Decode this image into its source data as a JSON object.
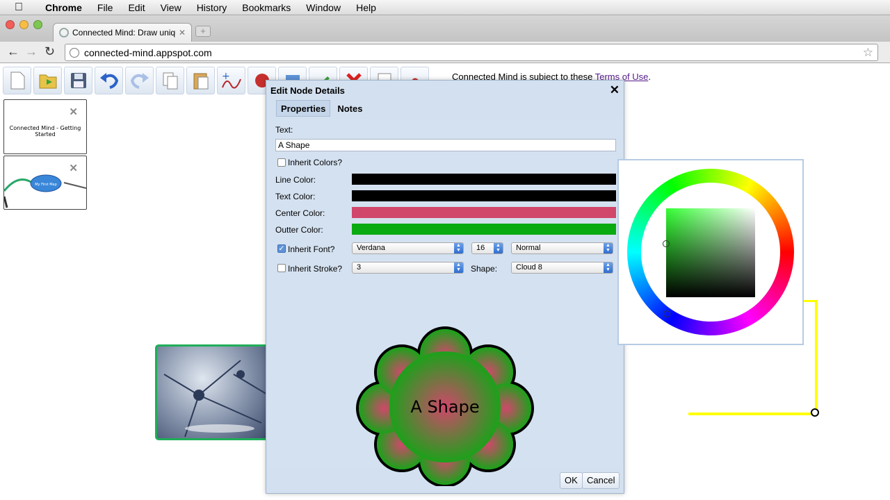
{
  "menubar": {
    "app": "Chrome",
    "items": [
      "File",
      "Edit",
      "View",
      "History",
      "Bookmarks",
      "Window",
      "Help"
    ]
  },
  "browser": {
    "tab_title": "Connected Mind: Draw uniqu",
    "url": "connected-mind.appspot.com"
  },
  "page": {
    "terms_prefix": "Connected Mind is subject to these",
    "terms_link": "Terms of Use",
    "terms_suffix": ".",
    "thumbnails": [
      {
        "label": "Connected Mind - Getting Started"
      },
      {
        "label": "My First Map"
      }
    ]
  },
  "dialog": {
    "title": "Edit Node Details",
    "tabs": [
      "Properties",
      "Notes"
    ],
    "text_label": "Text:",
    "text_value": "A Shape",
    "inherit_colors_label": "Inherit Colors?",
    "inherit_colors": false,
    "line_color_label": "Line Color:",
    "text_color_label": "Text Color:",
    "center_color_label": "Center Color:",
    "outter_color_label": "Outter Color:",
    "colors": {
      "line": "#000000",
      "text": "#000000",
      "center": "#d0476b",
      "outter": "#0aaa12"
    },
    "inherit_font_label": "Inherit Font?",
    "inherit_font": true,
    "font_family": "Verdana",
    "font_size": "16",
    "font_weight": "Normal",
    "inherit_stroke_label": "Inherit Stroke?",
    "inherit_stroke": false,
    "stroke": "3",
    "shape_label": "Shape:",
    "shape": "Cloud 8",
    "preview_text": "A Shape",
    "ok": "OK",
    "cancel": "Cancel"
  }
}
